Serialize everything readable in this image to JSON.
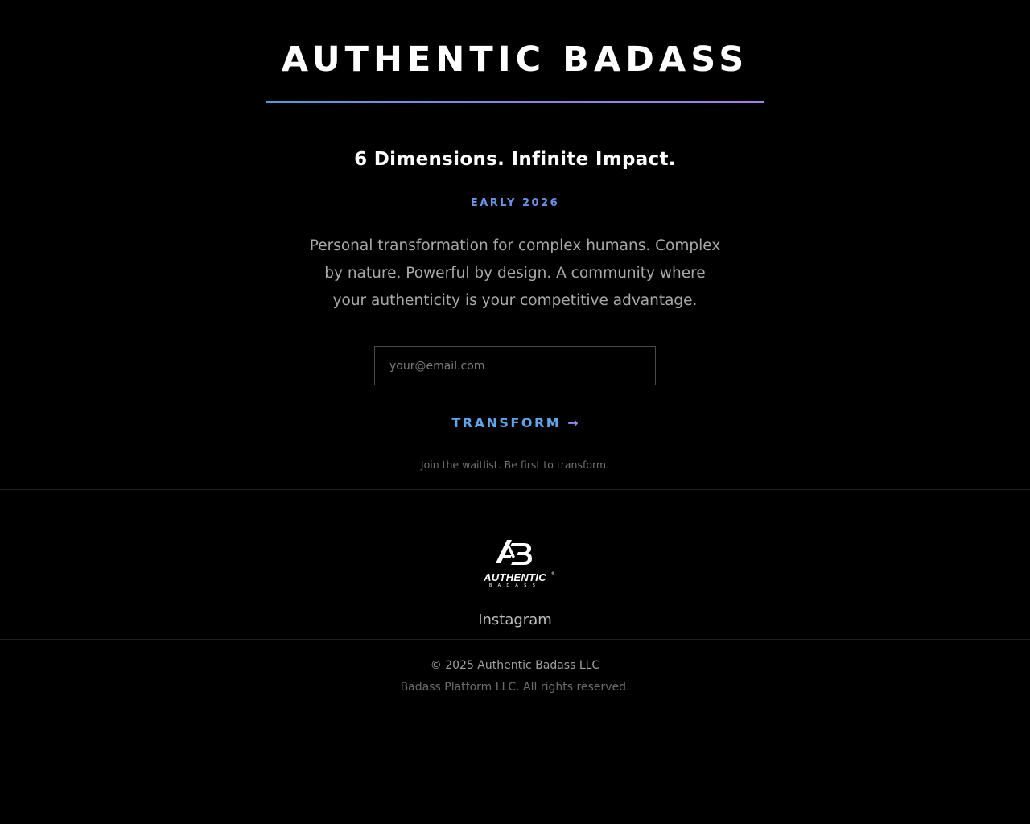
{
  "hero": {
    "title": "AUTHENTIC BADASS",
    "tagline": "6 Dimensions. Infinite Impact.",
    "launch": "EARLY 2026",
    "description": "Personal transformation for complex humans. Complex by nature. Powerful by design. A community where your authenticity is your competitive advantage.",
    "email_placeholder": "your@email.com",
    "email_value": "",
    "submit_label": "TRANSFORM",
    "submit_icon": "arrow-right-icon",
    "waitlist_note": "Join the waitlist. Be first to transform."
  },
  "footer": {
    "logo": {
      "monogram": "AB",
      "wordmark": "AUTHENTIC",
      "sub_wordmark": "BADASS",
      "mark": "®"
    },
    "social_link": "Instagram",
    "copyright": "© 2025 Authentic Badass LLC",
    "rights": "Badass Platform LLC. All rights reserved."
  },
  "colors": {
    "background": "#000000",
    "accent_blue": "#4a9fe0",
    "accent_purple": "#a67fe8",
    "body_text": "#a9a9a9"
  }
}
